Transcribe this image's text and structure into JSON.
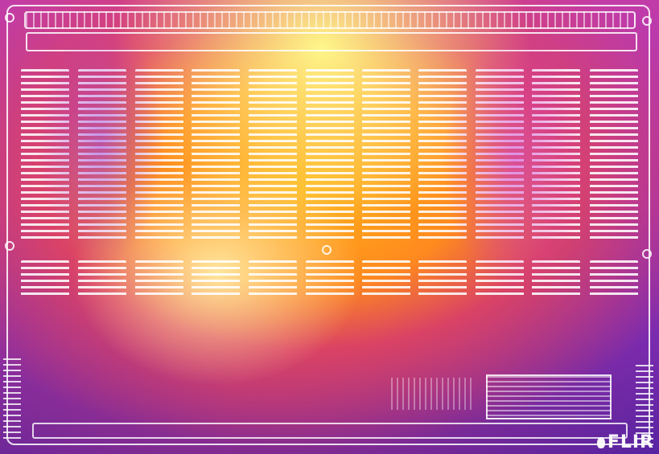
{
  "image": {
    "kind": "thermal-camera-photo",
    "subject": "laptop-bottom-panel",
    "palette": "iron"
  },
  "logo": {
    "icon": "flame-logo-icon",
    "text": "FLIR"
  }
}
